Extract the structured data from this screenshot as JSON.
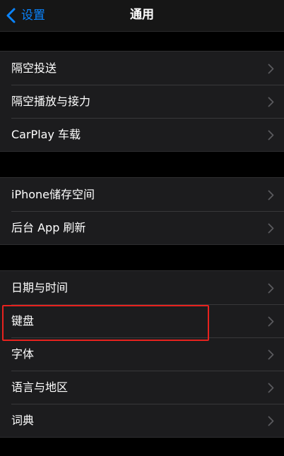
{
  "nav": {
    "back_label": "设置",
    "title": "通用"
  },
  "groups": [
    {
      "items": [
        {
          "label": "隔空投送"
        },
        {
          "label": "隔空播放与接力"
        },
        {
          "label": "CarPlay 车载"
        }
      ]
    },
    {
      "items": [
        {
          "label": "iPhone储存空间"
        },
        {
          "label": "后台 App 刷新"
        }
      ]
    },
    {
      "items": [
        {
          "label": "日期与时间"
        },
        {
          "label": "键盘"
        },
        {
          "label": "字体"
        },
        {
          "label": "语言与地区"
        },
        {
          "label": "词典"
        }
      ]
    }
  ],
  "highlighted_item": "键盘",
  "icons": {
    "back": "chevron-left-icon",
    "row_disclosure": "chevron-right-icon"
  },
  "colors": {
    "accent": "#0a84ff",
    "highlight": "#e8221e",
    "cell_background": "#1c1c1e",
    "page_background": "#000000"
  }
}
